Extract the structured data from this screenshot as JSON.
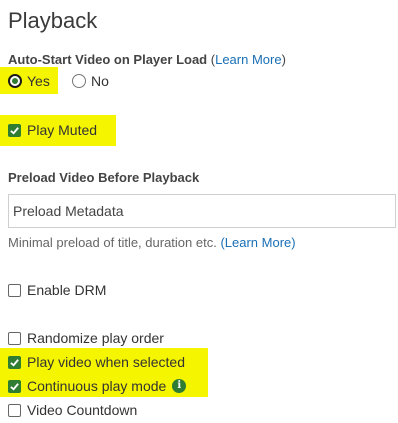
{
  "section": {
    "title": "Playback"
  },
  "autostart": {
    "label": "Auto-Start Video on Player Load",
    "learn_more_open": "(",
    "learn_more": "Learn More",
    "learn_more_close": ")",
    "options": [
      {
        "label": "Yes",
        "selected": true
      },
      {
        "label": "No",
        "selected": false
      }
    ]
  },
  "play_muted": {
    "label": "Play Muted",
    "checked": true
  },
  "preload": {
    "label": "Preload Video Before Playback",
    "value": "Preload Metadata",
    "help": "Minimal preload of title, duration etc.",
    "learn_more": "(Learn More)"
  },
  "drm": {
    "label": "Enable DRM",
    "checked": false
  },
  "options": [
    {
      "label": "Randomize play order",
      "checked": false
    },
    {
      "label": "Play video when selected",
      "checked": true
    },
    {
      "label": "Continuous play mode",
      "checked": true,
      "info_icon": "info-icon"
    },
    {
      "label": "Video Countdown",
      "checked": false
    }
  ],
  "colors": {
    "highlight": "#f5f500",
    "accent": "#2e7d32",
    "link": "#1a6fb5"
  }
}
